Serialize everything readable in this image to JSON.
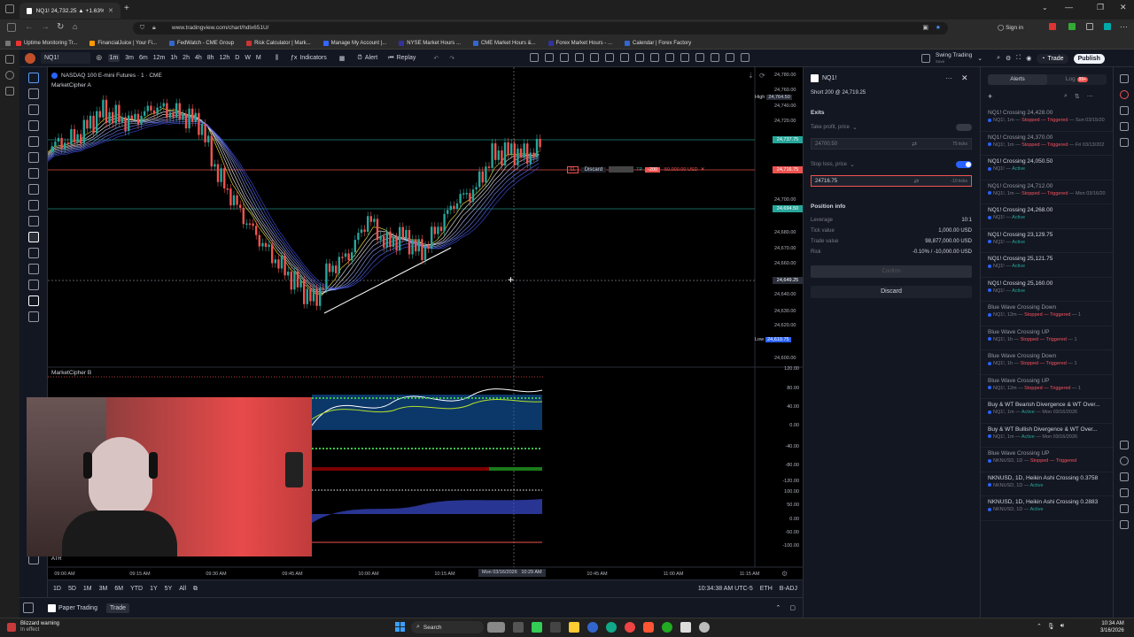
{
  "browser": {
    "tabs": [
      {
        "label": "NQ1! 24,732.25 ▲ +1.63% Swi..."
      }
    ],
    "url": "www.tradingview.com/chart/hdlx651U/",
    "bookmarks": [
      "Uptime Monitoring Tr...",
      "FinancialJuice | Your Fi...",
      "FedWatch - CME Group",
      "Risk Calculator | Mark...",
      "Manage My Account |...",
      "NYSE Market Hours ...",
      "CME Market Hours &...",
      "Forex Market Hours - ...",
      "Calendar | Forex Factory"
    ]
  },
  "toolbar": {
    "symbol": "NQ1!",
    "intervals": [
      "1m",
      "3m",
      "6m",
      "12m",
      "1h",
      "2h",
      "4h",
      "8h",
      "12h",
      "D",
      "W",
      "M"
    ],
    "indicators_label": "Indicators",
    "alert_label": "Alert",
    "replay_label": "Replay",
    "layout_name": "Swing Trading",
    "layout_sub": "Save",
    "trade_label": "Trade",
    "publish_label": "Publish"
  },
  "chart": {
    "title": "NASDAQ 100 E-mini Futures · 1 · CME",
    "indicator_a": "MarketCipher A",
    "indicator_b": "MarketCipher B",
    "atr_label": "ATR",
    "price_ticks": [
      "24,780.00",
      "24,760.00",
      "24,740.00",
      "24,720.00",
      "24,700.00",
      "24,680.00",
      "24,670.00",
      "24,660.00",
      "24,640.00",
      "24,630.00",
      "24,620.00",
      "24,600.00"
    ],
    "osc_ticks": [
      "120.00",
      "80.00",
      "40.00",
      "0.00",
      "-40.00",
      "-80.00",
      "-120.00",
      "100.00",
      "50.00",
      "0.00",
      "-50.00",
      "-100.00"
    ],
    "high_label": "High",
    "high_value": "24,764.50",
    "low_label": "Low",
    "low_value": "24,610.75",
    "cursor_price": "24,649.25",
    "last_price": "24,737.75",
    "sl_price": "24,716.75",
    "green_level": "24,694.50",
    "time_ticks": [
      "09:00 AM",
      "09:15 AM",
      "09:30 AM",
      "09:45 AM",
      "10:00 AM",
      "10:15 AM",
      "10:45 AM",
      "11:00 AM",
      "11:15 AM"
    ],
    "cursor_time": "Mon 03/16/2026   10:29 AM",
    "order_line": {
      "sl_tag": "SL",
      "discard": "Discard",
      "tp_tag": "TP",
      "pnl": "-200",
      "pnl_usd": "-50,000.00 USD"
    },
    "clock": "10:34:38 AM UTC-5",
    "session": "ETH",
    "adj": "B-ADJ",
    "ranges": [
      "1D",
      "5D",
      "1M",
      "3M",
      "6M",
      "YTD",
      "1Y",
      "5Y",
      "All"
    ]
  },
  "order_panel": {
    "symbol": "NQ1!",
    "order_desc": "Short 200 @ 24,719.25",
    "exits_label": "Exits",
    "tp_label": "Take profit, price",
    "tp_value": "24700.50",
    "tp_ticks": "75 ticks",
    "sl_label": "Stop loss, price",
    "sl_value": "24716.75",
    "sl_ticks": "-10 ticks",
    "position_info_label": "Position info",
    "rows": [
      {
        "label": "Leverage",
        "value": "10:1"
      },
      {
        "label": "Tick value",
        "value": "1,000.00 USD"
      },
      {
        "label": "Trade value",
        "value": "98,877,000.00 USD"
      },
      {
        "label": "Risk",
        "value": "-0.10% / -10,000.00 USD"
      }
    ],
    "confirm_label": "Confirm",
    "discard_label": "Discard"
  },
  "alerts_panel": {
    "tab_alerts": "Alerts",
    "tab_log": "Log",
    "log_badge": "99+",
    "items": [
      {
        "title": "NQ1! Crossing 24,428.00",
        "sub": "NQ1!, 1m",
        "status": "Stopped — Triggered",
        "date": "Sun 03/15/20",
        "status_color": "#f7525f"
      },
      {
        "title": "NQ1! Crossing 24,370.00",
        "sub": "NQ1!, 1m",
        "status": "Stopped — Triggered",
        "date": "Fri 03/13/202",
        "status_color": "#f7525f"
      },
      {
        "title": "NQ1! Crossing 24,050.50",
        "sub": "NQ1!",
        "status": "Active",
        "date": "",
        "status_color": "#26a69a"
      },
      {
        "title": "NQ1! Crossing 24,712.00",
        "sub": "NQ1!, 1m",
        "status": "Stopped — Triggered",
        "date": "Mon 03/16/20",
        "status_color": "#f7525f"
      },
      {
        "title": "NQ1! Crossing 24,268.00",
        "sub": "NQ1!",
        "status": "Active",
        "date": "",
        "status_color": "#26a69a"
      },
      {
        "title": "NQ1! Crossing 23,129.75",
        "sub": "NQ1!",
        "status": "Active",
        "date": "",
        "status_color": "#26a69a"
      },
      {
        "title": "NQ1! Crossing 25,121.75",
        "sub": "NQ1!",
        "status": "Active",
        "date": "",
        "status_color": "#26a69a"
      },
      {
        "title": "NQ1! Crossing 25,160.00",
        "sub": "NQ1!",
        "status": "Active",
        "date": "",
        "status_color": "#26a69a"
      },
      {
        "title": "Blue Wave Crossing Down",
        "sub": "NQ1!, 12m",
        "status": "Stopped — Triggered",
        "date": "1",
        "status_color": "#f7525f"
      },
      {
        "title": "Blue Wave Crossing UP",
        "sub": "NQ1!, 1h",
        "status": "Stopped — Triggered",
        "date": "1",
        "status_color": "#f7525f"
      },
      {
        "title": "Blue Wave Crossing Down",
        "sub": "NQ1!, 1h",
        "status": "Stopped — Triggered",
        "date": "1",
        "status_color": "#f7525f"
      },
      {
        "title": "Blue Wave Crossing UP",
        "sub": "NQ1!, 12m",
        "status": "Stopped — Triggered",
        "date": "1",
        "status_color": "#f7525f"
      },
      {
        "title": "Buy & WT Bearish Divergence & WT Over...",
        "sub": "NQ1!, 1m",
        "status": "Active",
        "date": "Mon 03/16/2026",
        "status_color": "#26a69a"
      },
      {
        "title": "Buy & WT Bullish Divergence & WT Over...",
        "sub": "NQ1!, 1m",
        "status": "Active",
        "date": "Mon 03/16/2026",
        "status_color": "#26a69a"
      },
      {
        "title": "Blue Wave Crossing UP",
        "sub": "NKNUSD, 1D",
        "status": "Stopped — Triggered",
        "date": "",
        "status_color": "#f7525f"
      },
      {
        "title": "NKNUSD, 1D, Heikin Ashi Crossing 0.3758",
        "sub": "NKNUSD, 1D",
        "status": "Active",
        "date": "",
        "status_color": "#26a69a"
      },
      {
        "title": "NKNUSD, 1D, Heikin Ashi Crossing 0.2883",
        "sub": "NKNUSD, 1D",
        "status": "Active",
        "date": "",
        "status_color": "#26a69a"
      }
    ]
  },
  "bottom_tabs": {
    "paper": "Paper Trading",
    "trade": "Trade"
  },
  "taskbar": {
    "weather_title": "Blizzard warning",
    "weather_sub": "In effect",
    "search": "Search",
    "time": "10:34 AM",
    "date": "3/16/2026"
  },
  "colors": {
    "bull": "#26a69a",
    "bear": "#ef5350",
    "accent": "#2962ff"
  }
}
